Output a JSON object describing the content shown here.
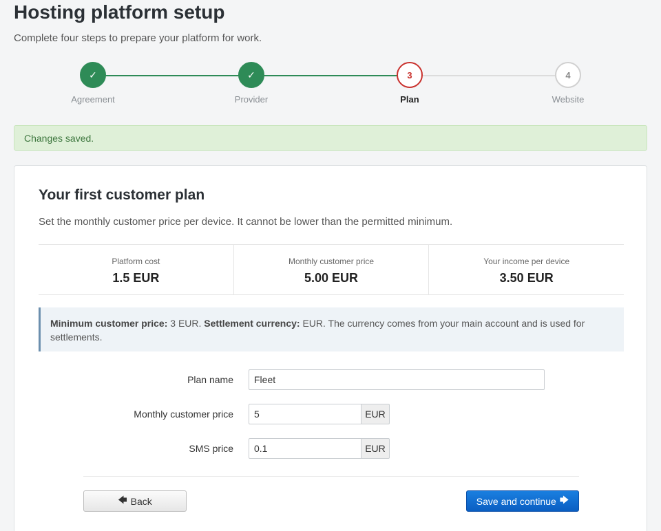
{
  "header": {
    "title": "Hosting platform setup",
    "subtitle": "Complete four steps to prepare your platform for work."
  },
  "stepper": {
    "steps": [
      {
        "marker": "✓",
        "label": "Agreement",
        "state": "done"
      },
      {
        "marker": "✓",
        "label": "Provider",
        "state": "done"
      },
      {
        "marker": "3",
        "label": "Plan",
        "state": "active"
      },
      {
        "marker": "4",
        "label": "Website",
        "state": "pending"
      }
    ]
  },
  "alert": {
    "message": "Changes saved."
  },
  "card": {
    "title": "Your first customer plan",
    "description": "Set the monthly customer price per device. It cannot be lower than the permitted minimum.",
    "stats": [
      {
        "label": "Platform cost",
        "value": "1.5 EUR"
      },
      {
        "label": "Monthly customer price",
        "value": "5.00 EUR"
      },
      {
        "label": "Your income per device",
        "value": "3.50 EUR"
      }
    ],
    "info": {
      "min_price_label": "Minimum customer price:",
      "min_price_value": " 3 EUR. ",
      "currency_label": "Settlement currency:",
      "currency_text": " EUR. The currency comes from your main account and is used for settlements."
    },
    "form": {
      "plan_name_label": "Plan name",
      "plan_name_value": "Fleet",
      "monthly_price_label": "Monthly customer price",
      "monthly_price_value": "5",
      "monthly_price_unit": "EUR",
      "sms_price_label": "SMS price",
      "sms_price_value": "0.1",
      "sms_price_unit": "EUR"
    },
    "buttons": {
      "back_label": "Back",
      "back_icon": "arrow-left-icon",
      "save_label": "Save and continue",
      "save_icon": "arrow-right-icon"
    }
  },
  "colors": {
    "done": "#2e8b57",
    "active": "#c9302c",
    "primary": "#0a5ec2",
    "success_bg": "#dff0d8"
  }
}
